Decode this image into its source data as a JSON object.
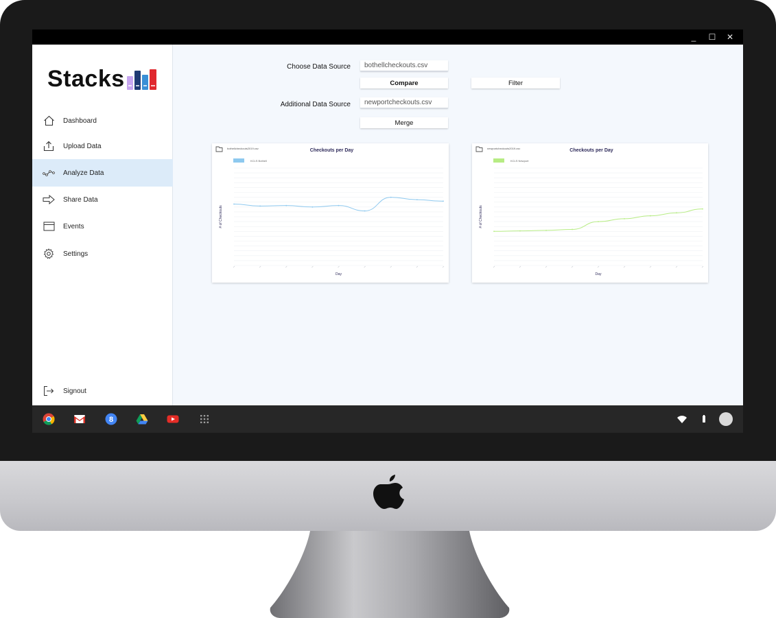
{
  "window": {
    "minimize_glyph": "_",
    "maximize_glyph": "☐",
    "close_glyph": "✕"
  },
  "brand": {
    "name": "Stacks",
    "logo_colors": [
      "#c7a6f0",
      "#1f3a73",
      "#3a8fd6",
      "#e0282e"
    ]
  },
  "sidebar": {
    "items": [
      {
        "label": "Dashboard",
        "icon": "home-icon"
      },
      {
        "label": "Upload Data",
        "icon": "upload-icon"
      },
      {
        "label": "Analyze Data",
        "icon": "analyze-icon",
        "active": true
      },
      {
        "label": "Share Data",
        "icon": "share-arrow-icon"
      },
      {
        "label": "Events",
        "icon": "calendar-icon"
      },
      {
        "label": "Settings",
        "icon": "gear-icon"
      }
    ],
    "signout": {
      "label": "Signout",
      "icon": "signout-icon"
    }
  },
  "form": {
    "source_label": "Choose Data Source",
    "source_value": "bothellcheckouts.csv",
    "compare_label": "Compare",
    "filter_label": "Filter",
    "additional_label": "Additional Data Source",
    "additional_value": "newportcheckouts.csv",
    "merge_label": "Merge"
  },
  "charts": [
    {
      "file_label": "bothellcheckouts2019.csv",
      "file_icon": "folder-icon"
    },
    {
      "file_label": "newportcheckouts2019.csv",
      "file_icon": "folder-icon"
    }
  ],
  "chart_data": [
    {
      "type": "line",
      "title": "Checkouts per Day",
      "xlabel": "Day",
      "ylabel": "# of Checkouts",
      "series": [
        {
          "name": "KCLS Bothell",
          "color": "#8ec9ef",
          "values": [
            63,
            61,
            61.5,
            60,
            61.5,
            56,
            70,
            67.5,
            66
          ]
        }
      ],
      "x": [
        1,
        2,
        3,
        4,
        5,
        6,
        7,
        8,
        9
      ],
      "ylim": [
        0,
        100
      ],
      "grid": true,
      "legend": "top-left"
    },
    {
      "type": "line",
      "title": "Checkouts per Day",
      "xlabel": "Day",
      "ylabel": "# of Checkouts",
      "series": [
        {
          "name": "KCLS Newport",
          "color": "#b7ec84",
          "values": [
            35,
            35.5,
            36,
            37,
            45,
            48,
            51,
            54,
            58
          ]
        }
      ],
      "x": [
        1,
        2,
        3,
        4,
        5,
        6,
        7,
        8,
        9
      ],
      "ylim": [
        0,
        100
      ],
      "grid": true,
      "legend": "top-left"
    }
  ],
  "taskbar": {
    "apps": [
      "chrome-icon",
      "gmail-icon",
      "google-plus-icon",
      "drive-icon",
      "youtube-icon",
      "app-launcher-icon"
    ],
    "status": [
      "wifi-icon",
      "battery-icon",
      "avatar"
    ]
  }
}
